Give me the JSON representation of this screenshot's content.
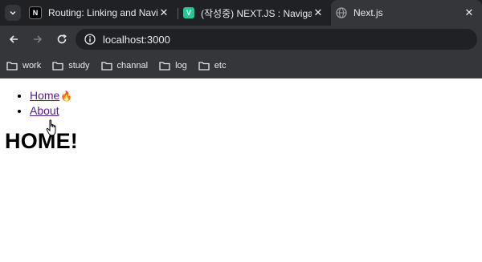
{
  "browser": {
    "tabs": [
      {
        "title": "Routing: Linking and Navigatin",
        "favicon": "nextjs-favicon",
        "active": false
      },
      {
        "title": "(작성중) NEXT.JS : Navigation",
        "favicon": "velog-favicon",
        "active": false
      },
      {
        "title": "Next.js",
        "favicon": "globe-favicon",
        "active": true
      }
    ],
    "address": "localhost:3000",
    "bookmarks": [
      "work",
      "study",
      "channal",
      "log",
      "etc"
    ]
  },
  "page": {
    "nav_links": [
      "Home",
      "About"
    ],
    "home_emoji": "🔥",
    "heading": "HOME!"
  }
}
